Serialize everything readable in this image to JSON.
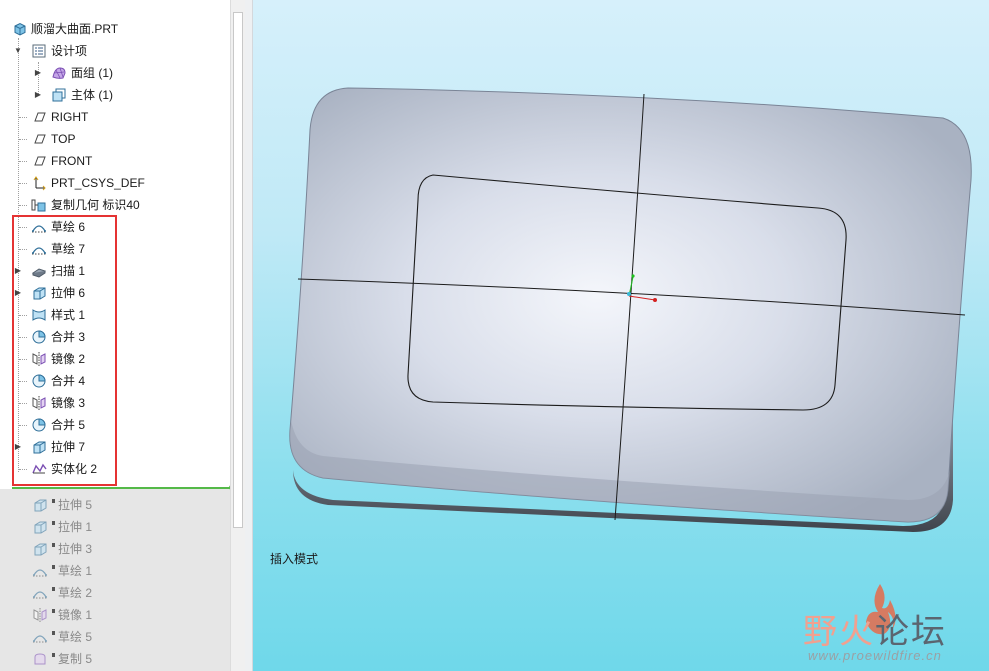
{
  "model_tree": {
    "root": {
      "label": "顺溜大曲面.PRT",
      "icon": "part-icon"
    },
    "items": [
      {
        "label": "设计项",
        "icon": "design-items-icon",
        "toggle": "collapse"
      },
      {
        "label": "面组 (1)",
        "icon": "quilt-icon",
        "toggle": "expand"
      },
      {
        "label": "主体 (1)",
        "icon": "body-icon",
        "toggle": "expand"
      },
      {
        "label": "RIGHT",
        "icon": "datum-plane-icon"
      },
      {
        "label": "TOP",
        "icon": "datum-plane-icon"
      },
      {
        "label": "FRONT",
        "icon": "datum-plane-icon"
      },
      {
        "label": "PRT_CSYS_DEF",
        "icon": "csys-icon"
      },
      {
        "label": "复制几何 标识40",
        "icon": "copy-geometry-icon"
      },
      {
        "label": "草绘 6",
        "icon": "sketch-icon"
      },
      {
        "label": "草绘 7",
        "icon": "sketch-icon"
      },
      {
        "label": "扫描 1",
        "icon": "sweep-icon",
        "toggle": "expand"
      },
      {
        "label": "拉伸 6",
        "icon": "extrude-icon",
        "toggle": "expand"
      },
      {
        "label": "样式 1",
        "icon": "style-icon"
      },
      {
        "label": "合并 3",
        "icon": "merge-icon"
      },
      {
        "label": "镜像 2",
        "icon": "mirror-icon"
      },
      {
        "label": "合并 4",
        "icon": "merge-icon"
      },
      {
        "label": "镜像 3",
        "icon": "mirror-icon"
      },
      {
        "label": "合并 5",
        "icon": "merge-icon"
      },
      {
        "label": "拉伸 7",
        "icon": "extrude-icon",
        "toggle": "expand"
      },
      {
        "label": "实体化 2",
        "icon": "solidify-icon"
      }
    ],
    "suppressed_items": [
      {
        "label": "拉伸 5",
        "icon": "extrude-icon"
      },
      {
        "label": "拉伸 1",
        "icon": "extrude-icon"
      },
      {
        "label": "拉伸 3",
        "icon": "extrude-icon"
      },
      {
        "label": "草绘 1",
        "icon": "sketch-icon"
      },
      {
        "label": "草绘 2",
        "icon": "sketch-icon"
      },
      {
        "label": "镜像 1",
        "icon": "mirror-icon"
      },
      {
        "label": "草绘 5",
        "icon": "sketch-icon"
      },
      {
        "label": "复制 5",
        "icon": "copy-icon"
      }
    ]
  },
  "viewport": {
    "mode_label": "插入模式",
    "watermark": {
      "text_part1": "野火",
      "text_part2": "论坛",
      "url": "www.proewildfire.cn"
    }
  },
  "colors": {
    "highlight_box": "#e53333",
    "insert_line": "#54b948",
    "viewport_bg_top": "#d6f0fb",
    "viewport_bg_bottom": "#6fd8ea"
  }
}
